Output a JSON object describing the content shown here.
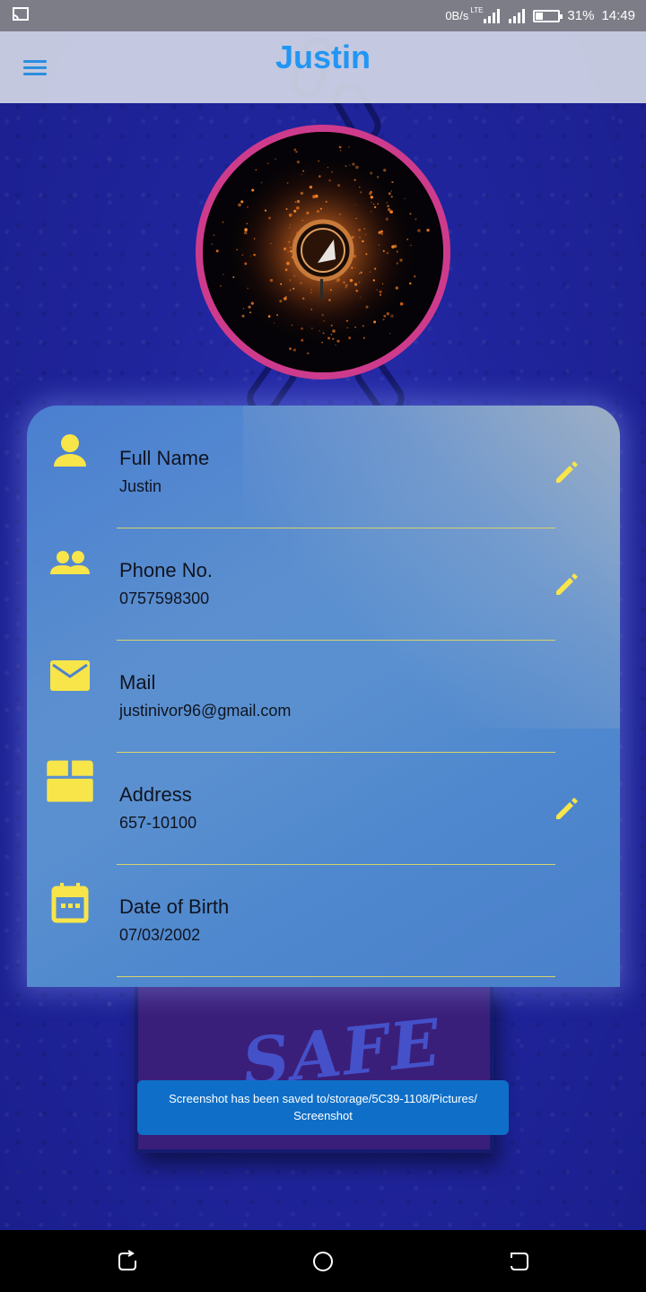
{
  "status_bar": {
    "net_speed": "0B/s",
    "network_type": "LTE",
    "battery_percent": "31%",
    "battery_level": 0.31,
    "time": "14:49",
    "cast_icon": "screen-cast-icon",
    "signal_icons": [
      "signal-icon",
      "signal-icon"
    ]
  },
  "app_bar": {
    "title": "Justin",
    "menu_icon": "hamburger-menu-icon"
  },
  "colors": {
    "accent": "#2196f3",
    "icon_yellow": "#f8e54a",
    "avatar_ring": "#cf3b8c",
    "toast_bg": "#0f6fc8"
  },
  "profile": {
    "rows": [
      {
        "icon": "person-icon",
        "label": "Full Name",
        "value": "Justin",
        "editable": true
      },
      {
        "icon": "people-icon",
        "label": "Phone No.",
        "value": "0757598300",
        "editable": true
      },
      {
        "icon": "mail-icon",
        "label": "Mail",
        "value": "justinivor96@gmail.com",
        "editable": false
      },
      {
        "icon": "box-icon",
        "label": "Address",
        "value": "657-10100",
        "editable": true
      },
      {
        "icon": "calendar-icon",
        "label": "Date of Birth",
        "value": "07/03/2002",
        "editable": false
      }
    ],
    "edit_icon": "pencil-edit-icon"
  },
  "background": {
    "sign_text": "SAFE"
  },
  "toast": {
    "line1": "Screenshot has been saved to/storage/5C39-1108/Pictures/",
    "line2": "Screenshot"
  },
  "nav_bar": {
    "icons": [
      "back-icon",
      "home-icon",
      "recents-icon"
    ]
  }
}
